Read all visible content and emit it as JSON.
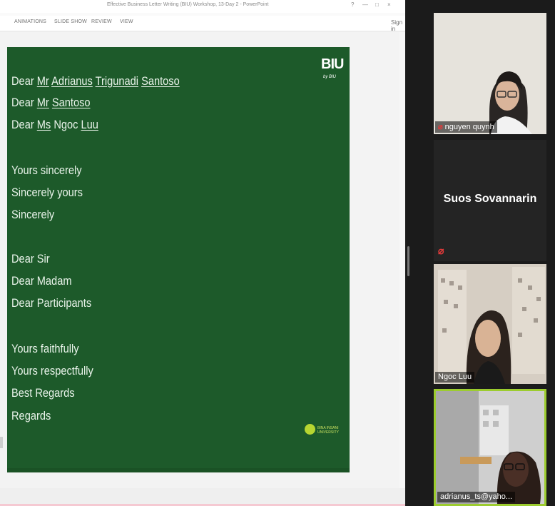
{
  "window": {
    "title": "Effective Business Letter Writing (BIU) Workshop, 13-Day 2 - PowerPoint",
    "controls": [
      "?",
      "—",
      "□",
      "×"
    ]
  },
  "ribbon": {
    "tabs": [
      "ANIMATIONS",
      "SLIDE SHOW",
      "REVIEW",
      "VIEW"
    ],
    "sign_in": "Sign in"
  },
  "slide": {
    "logo_text": "BIU",
    "logo_tagline": "by BIU",
    "badge_text": "BINA INSANI UNIVERSITY",
    "lines": [
      {
        "pre": "Dear ",
        "u1": "Mr",
        "mid": " ",
        "u2": "Adrianus",
        "mid2": " ",
        "u3": "Trigunadi",
        "mid3": " ",
        "u4": "Santoso"
      },
      {
        "pre": "Dear ",
        "u1": "Mr",
        "mid": " ",
        "u2": "Santoso"
      },
      {
        "pre": "Dear ",
        "u1": "Ms",
        "mid": " Ngoc ",
        "u2": "Luu"
      }
    ],
    "closings1": [
      "Yours sincerely",
      "Sincerely yours",
      "Sincerely"
    ],
    "salutations": [
      "Dear Sir",
      "Dear Madam",
      "Dear Participants"
    ],
    "closings2": [
      "Yours faithfully",
      "Yours respectfully",
      "Best Regards",
      "Regards"
    ]
  },
  "participants": [
    {
      "name": "nguyen quynh",
      "muted": true
    },
    {
      "name": "Suos Sovannarin",
      "muted": true
    },
    {
      "name": "Ngoc Luu",
      "muted": false
    },
    {
      "name": "adrianus_ts@yaho...",
      "muted": false
    }
  ],
  "colors": {
    "slide_bg": "#1d5a2a",
    "active_speaker": "#9ccc2f",
    "mute": "#e23a3a"
  }
}
